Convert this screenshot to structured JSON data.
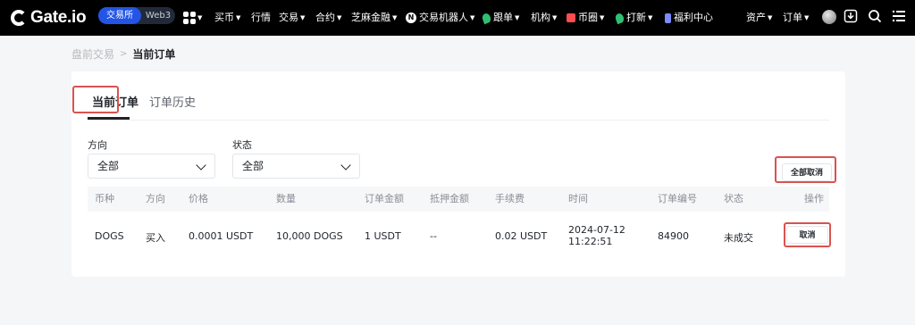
{
  "topbar": {
    "logo_text": "Gate.io",
    "mode_active": "交易所",
    "mode_other": "Web3",
    "nav": {
      "buy": "买币",
      "markets": "行情",
      "trade": "交易",
      "futures": "合约",
      "sesame": "芝麻金融",
      "bots": "交易机器人",
      "copy": "跟单",
      "institutional": "机构",
      "coin_circle": "币圈",
      "launch": "打新",
      "welfare": "福利中心"
    },
    "right": {
      "assets": "资产",
      "orders": "订单"
    },
    "icons": [
      "apps-grid-icon",
      "avatar",
      "download-icon",
      "search-icon",
      "menu-icon"
    ]
  },
  "breadcrumb": {
    "root": "盘前交易",
    "current": "当前订单"
  },
  "tabs": {
    "active": "当前订单",
    "history": "订单历史"
  },
  "filters": {
    "direction": {
      "label": "方向",
      "value": "全部"
    },
    "status": {
      "label": "状态",
      "value": "全部"
    }
  },
  "actions": {
    "cancel_all": "全部取消",
    "cancel": "取消"
  },
  "table": {
    "headers": {
      "coin": "币种",
      "side": "方向",
      "price": "价格",
      "amount": "数量",
      "order_value": "订单金额",
      "collateral": "抵押金额",
      "fee": "手续费",
      "time": "时间",
      "order_id": "订单编号",
      "status": "状态",
      "action": "操作"
    },
    "rows": [
      {
        "coin": "DOGS",
        "side": "买入",
        "price": "0.0001 USDT",
        "amount": "10,000 DOGS",
        "order_value": "1 USDT",
        "collateral": "--",
        "fee": "0.02 USDT",
        "date": "2024-07-12",
        "time": "11:22:51",
        "order_id": "84900",
        "status": "未成交"
      }
    ]
  },
  "colors": {
    "topbar_bg": "#000000",
    "mode_active_bg": "#2354e6",
    "highlight": "#d9534f"
  }
}
